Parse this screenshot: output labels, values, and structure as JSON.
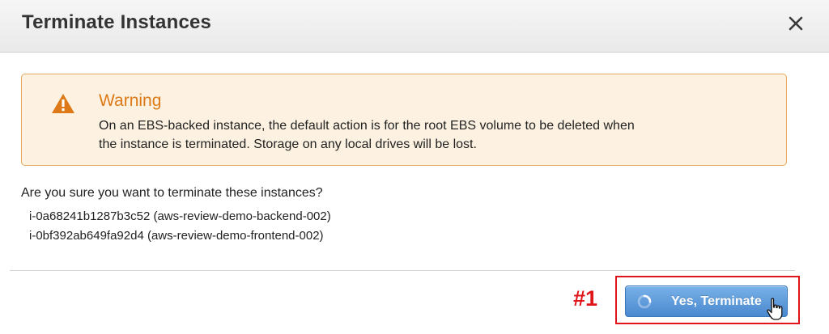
{
  "dialog": {
    "title": "Terminate Instances",
    "close_icon": "close-icon"
  },
  "warning": {
    "icon": "warning-icon",
    "title": "Warning",
    "message_line1": "On an EBS-backed instance, the default action is for the root EBS volume to be deleted when",
    "message_line2": "the instance is terminated. Storage on any local drives will be lost.",
    "accent_color": "#dd7a17",
    "background_color": "#fdf2e1"
  },
  "confirmation": {
    "question": "Are you sure you want to terminate these instances?",
    "instances": [
      "i-0a68241b1287b3c52 (aws-review-demo-backend-002)",
      "i-0bf392ab649fa92d4 (aws-review-demo-frontend-002)"
    ]
  },
  "annotation": {
    "label": "#1",
    "color": "#e0151a"
  },
  "actions": {
    "confirm_label": "Yes, Terminate",
    "confirm_icon": "spinner-icon",
    "button_color": "#4a89cf"
  },
  "cursor": {
    "icon": "hand-pointer-icon"
  }
}
